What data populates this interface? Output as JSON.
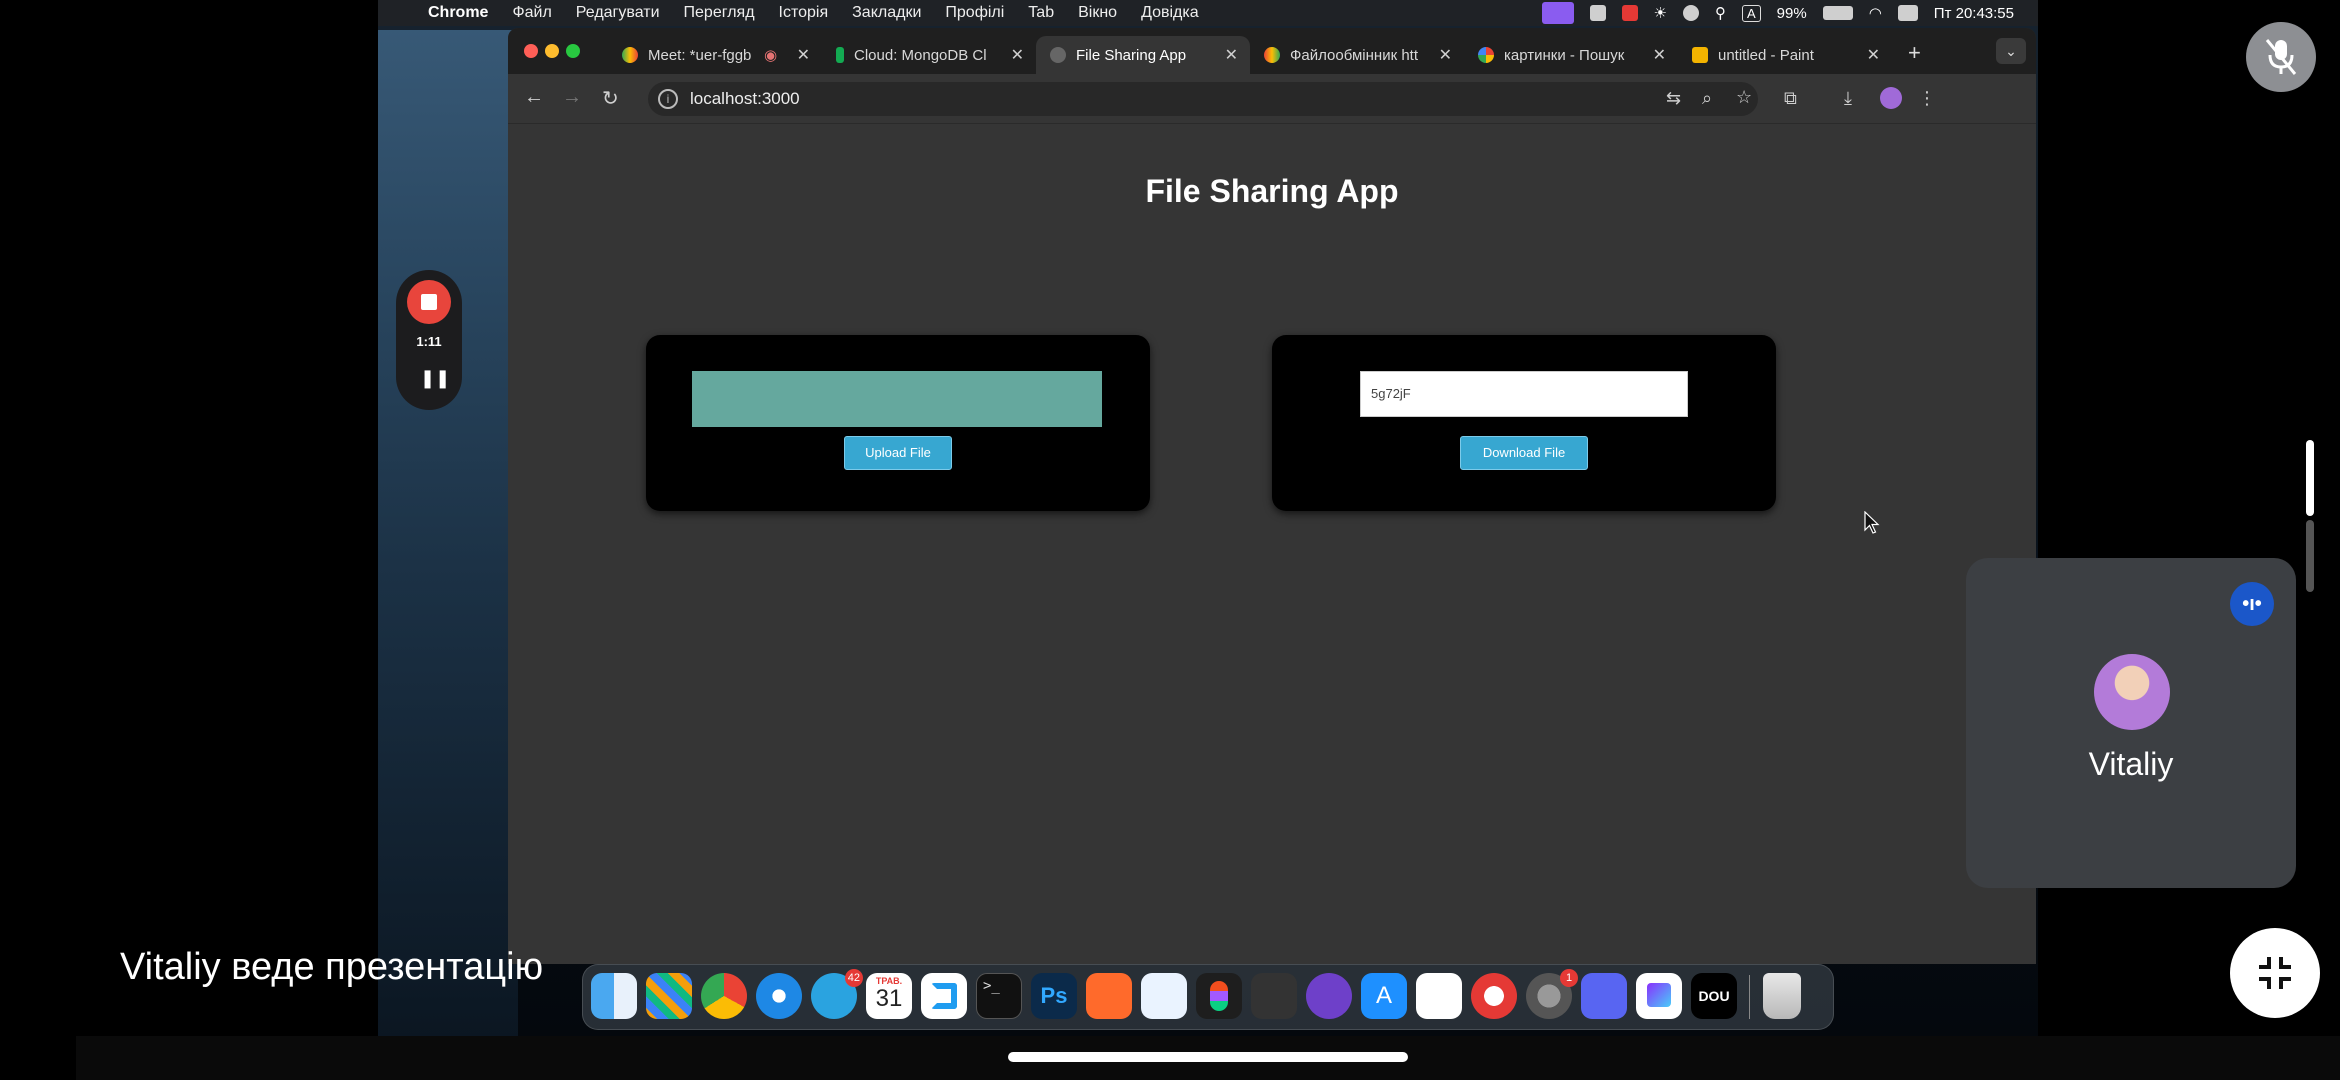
{
  "menubar": {
    "app": "Chrome",
    "items": [
      "Файл",
      "Редагувати",
      "Перегляд",
      "Історія",
      "Закладки",
      "Профілі",
      "Tab",
      "Вікно",
      "Довідка"
    ],
    "battery": "99%",
    "datetime": "Пт 20:43:55",
    "input_source": "A"
  },
  "browser": {
    "tabs": [
      {
        "title": "Meet: *uer-fggb"
      },
      {
        "title": "Cloud: MongoDB Cl"
      },
      {
        "title": "File Sharing App",
        "active": true
      },
      {
        "title": "Файлообмінник htt"
      },
      {
        "title": "картинки - Пошук"
      },
      {
        "title": "untitled - Paint"
      }
    ],
    "url": "localhost:3000"
  },
  "page": {
    "title": "File Sharing App",
    "upload_button": "Upload File",
    "download_button": "Download File",
    "code_value": "5g72jF"
  },
  "dock": {
    "telegram_badge": "42",
    "calendar_month": "ТРАВ.",
    "calendar_day": "31",
    "settings_badge": "1",
    "dou_label": "DOU"
  },
  "meet": {
    "rec_time": "1:11",
    "participant": "Vitaliy",
    "presenting_text": "Vitaliy веде презентацію"
  }
}
